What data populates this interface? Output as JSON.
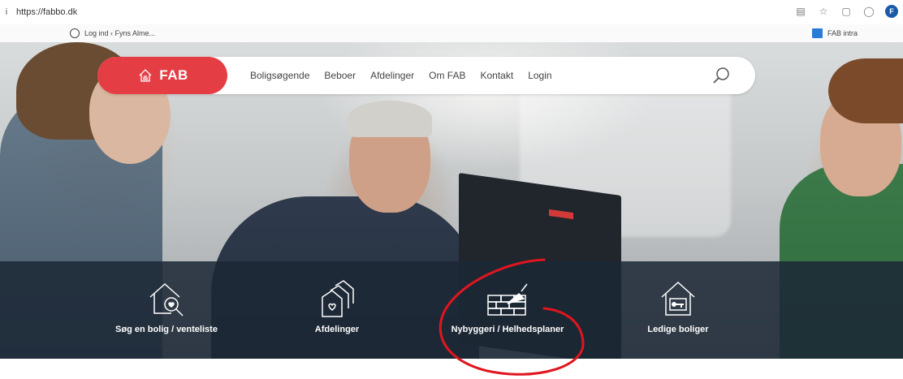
{
  "browser": {
    "url": "https://fabbo.dk",
    "profile_initial": "F",
    "bookmarks": [
      {
        "label": "Log ind ‹ Fyns Alme..."
      },
      {
        "label": "FAB intra"
      }
    ]
  },
  "site": {
    "logo_text": "FAB",
    "nav": [
      "Boligsøgende",
      "Beboer",
      "Afdelinger",
      "Om FAB",
      "Kontakt",
      "Login"
    ],
    "quick_links": [
      {
        "label": "Søg en bolig / venteliste",
        "icon": "house-search-icon"
      },
      {
        "label": "Afdelinger",
        "icon": "houses-heart-icon"
      },
      {
        "label": "Nybyggeri / Helhedsplaner",
        "icon": "bricks-trowel-icon"
      },
      {
        "label": "Ledige boliger",
        "icon": "house-key-icon"
      }
    ]
  },
  "colors": {
    "brand_red": "#e43e44",
    "band_dark": "#1c2836",
    "annotation_red": "#e0161e"
  }
}
